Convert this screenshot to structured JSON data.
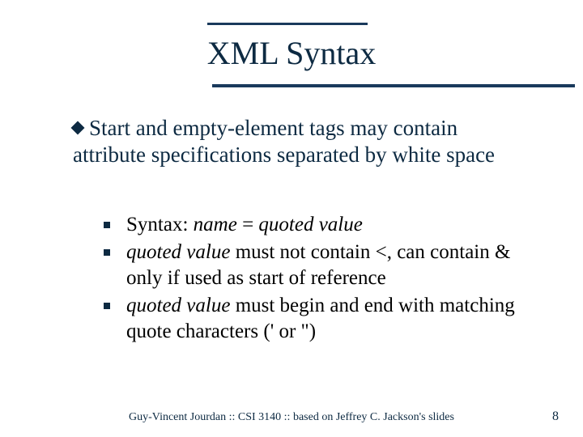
{
  "slide": {
    "title": "XML Syntax",
    "main_point": "Start and empty-element tags may contain attribute specifications separated by white space",
    "sub_points": [
      {
        "prefix": "Syntax: ",
        "italic1": "name",
        "mid1": " = ",
        "italic2": "quoted value",
        "tail": ""
      },
      {
        "prefix": "",
        "italic1": "quoted value",
        "mid1": " must not contain ",
        "mono1": "<",
        "mid2": ", can contain ",
        "mono2": "&",
        "tail": " only if used as start of reference"
      },
      {
        "prefix": "",
        "italic1": "quoted value",
        "mid1": " must begin and end with matching quote characters (",
        "mono1": "'",
        "mid2": " or ",
        "mono2": "\"",
        "tail": ")"
      }
    ],
    "footer": "Guy-Vincent Jourdan :: CSI 3140 :: based on Jeffrey C. Jackson's slides",
    "page_number": "8"
  }
}
